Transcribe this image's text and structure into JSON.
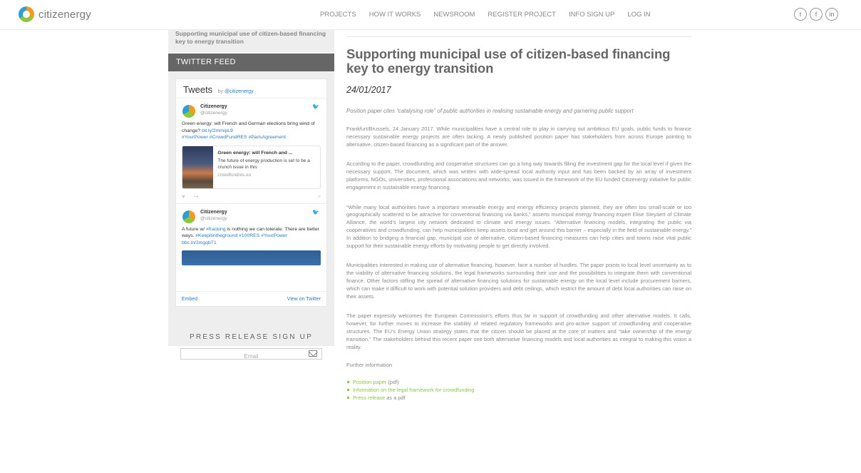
{
  "header": {
    "logo_text": "citizenergy",
    "nav": [
      "PROJECTS",
      "HOW IT WORKS",
      "NEWSROOM",
      "REGISTER PROJECT",
      "INFO SIGN UP",
      "LOG IN"
    ],
    "social": [
      "twitter-icon",
      "facebook-icon",
      "linkedin-icon"
    ],
    "social_glyphs": {
      "twitter": "t",
      "facebook": "f",
      "linkedin": "in"
    }
  },
  "sidebar": {
    "prev_title": "Supporting municipal use of citizen-based financing key to energy transition",
    "twitter_heading": "TWITTER FEED",
    "widget": {
      "title": "Tweets",
      "by": "by",
      "account": "@citizenergy",
      "embed": "Embed",
      "view_on_twitter": "View on Twitter",
      "tweets": [
        {
          "name": "Citizenergy",
          "handle": "@citizenergy",
          "text_plain": "Green energy: will French and German elections bring wind of change?",
          "link1": "bit.ly/2mmipL9",
          "tags": "#YourPower #CrowdFundRES #ParisAgreement",
          "preview_title": "Green energy: will French and ...",
          "preview_desc": "The future of energy production is set to be a crunch issue in this",
          "preview_domain": "crowdfundres.eu"
        },
        {
          "name": "Citizenergy",
          "handle": "@citizenergy",
          "text_a": "A future w/",
          "tag_a": "#fracking",
          "text_b": "is nothing we can tolerate. There are better ways.",
          "tags": "#Keepitintheground #100RES #YourPower",
          "link1": "bbc.in/2mgqbT1"
        }
      ]
    },
    "press": {
      "title": "PRESS RELEASE SIGN UP",
      "placeholder": "Email"
    }
  },
  "article": {
    "title": "Supporting municipal use of citizen-based financing key to energy transition",
    "date": "24/01/2017",
    "lead": "Position paper cites “catalysing role” of public authorities in realising sustainable energy and garnering public support",
    "paragraphs": [
      "Frankfurt/Brussels, 24 January 2017. While municipalities have a central role to play in carrying out ambitious EU goals, public funds to finance necessary sustainable energy projects are often lacking. A newly published position paper has stakeholders from across Europe pointing to alternative, citizen-based financing as a significant part of the answer.",
      "According to the paper, crowdfunding and cooperative structures can go a long way towards filling the investment gap for the local level if given the necessary support. The document, which was written with wide-spread local authority input and has been backed by an array of investment platforms, NGOs, universities, professional associations and networks, was issued in the framework of the EU funded Citizenergy initiative for public engagement in sustainable energy financing.",
      "“While many local authorities have a important renewable energy and energy efficiency projects planned, they are often too small-scale or too geographically scattered to be attractive for conventional financing via banks,” asserts municipal energy financing expert Elise Steyaert of Climate Alliance, the world’s largest city network dedicated to climate and energy issues. “Alternative financing models, integrating the public via cooperatives and crowdfunding, can help municipalities keep assets local and get around this barrier – especially in the field of sustainable energy.” In addition to bridging a financial gap, municipal use of alternative, citizen-based financing measures can help cities and towns raise vital public support for their sustainable energy efforts by motivating people to get directly involved.",
      "Municipalities interested in making use of alternative financing, however, face a number of hurdles. The paper points to local level uncertainty as to the viability of alternative financing solutions, the legal frameworks surrounding their use and the possibilities to integrate them with conventional finance. Other factors stifling the spread of alternative financing solutions for sustainable energy on the local level include procurement barriers, which can make it difficult to work with potential solution providers and debt ceilings, which restrict the amount of debt local authorities can raise on their assets.",
      "The paper expressly welcomes the European Commission’s efforts thus far in support of crowdfunding and other alternative models. It calls, however, for further moves to increase the stability of related regulatory frameworks and pro-active support of crowdfunding and cooperative structures. The EU’s Energy Union strategy states that the citizen should be placed at the core of matters and “take ownership of the energy transition.” The stakeholders behind this recent paper see both alternative financing models and local authorities as integral to making this vision a reality."
    ],
    "further_label": "Further information",
    "links": [
      {
        "link": "Position paper",
        "suffix": " (pdf)"
      },
      {
        "link": "Information on the legal framework for crowdfunding",
        "suffix": ""
      },
      {
        "link": "Press release",
        "suffix": " as a pdf"
      }
    ]
  }
}
